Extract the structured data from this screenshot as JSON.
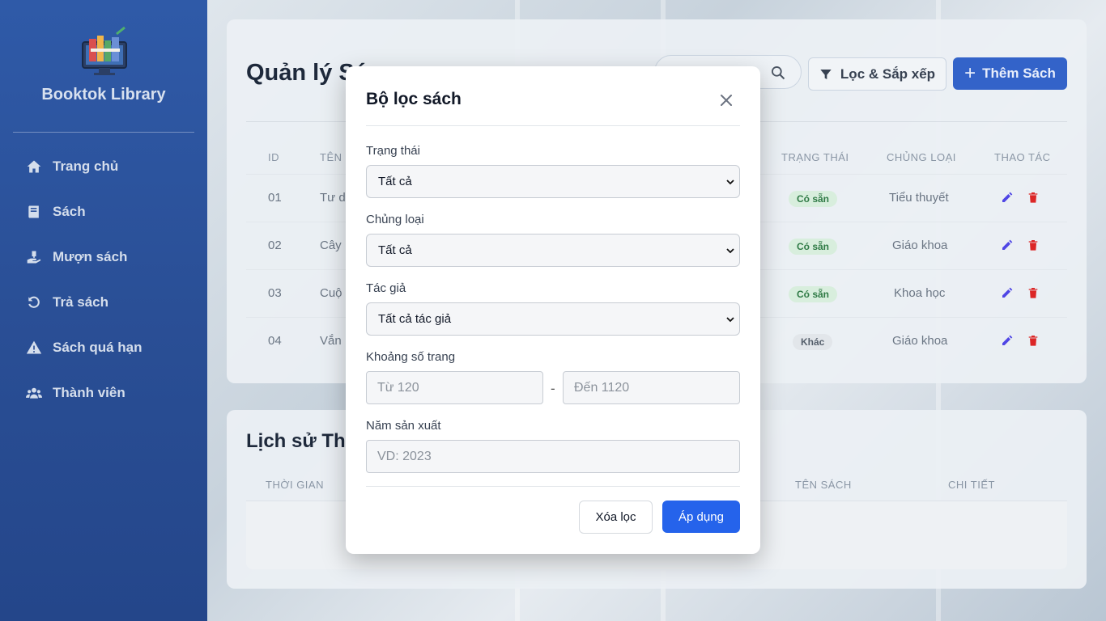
{
  "sidebar": {
    "brand": "Booktok Library",
    "items": [
      {
        "label": "Trang chủ",
        "icon": "home-icon"
      },
      {
        "label": "Sách",
        "icon": "book-icon"
      },
      {
        "label": "Mượn sách",
        "icon": "hand-book-icon"
      },
      {
        "label": "Trả sách",
        "icon": "undo-icon"
      },
      {
        "label": "Sách quá hạn",
        "icon": "warning-icon"
      },
      {
        "label": "Thành viên",
        "icon": "users-icon"
      }
    ]
  },
  "header": {
    "title": "Quản lý Sá",
    "filter_label": "Lọc & Sắp xếp",
    "add_label": "Thêm Sách"
  },
  "table": {
    "columns": [
      "ID",
      "TÊN",
      "TRẠNG THÁI",
      "CHỦNG LOẠI",
      "THAO TÁC"
    ],
    "rows": [
      {
        "id": "01",
        "name": "Tư d",
        "status": "Có sẵn",
        "category": "Tiểu thuyết"
      },
      {
        "id": "02",
        "name": "Cây",
        "status": "Có sẵn",
        "category": "Giáo khoa"
      },
      {
        "id": "03",
        "name": "Cuộ",
        "status": "Có sẵn",
        "category": "Khoa học"
      },
      {
        "id": "04",
        "name": "Vắn",
        "status": "Khác",
        "category": "Giáo khoa"
      }
    ]
  },
  "history": {
    "title": "Lịch sử Th",
    "columns": [
      "THỜI GIAN",
      "TÊN SÁCH",
      "CHI TIẾT"
    ]
  },
  "modal": {
    "title": "Bộ lọc sách",
    "status_label": "Trạng thái",
    "status_value": "Tất cả",
    "category_label": "Chủng loại",
    "category_value": "Tất cả",
    "author_label": "Tác giả",
    "author_value": "Tất cả tác giả",
    "pages_label": "Khoảng số trang",
    "pages_from_placeholder": "Từ 120",
    "pages_separator": "-",
    "pages_to_placeholder": "Đến 1120",
    "year_label": "Năm sản xuất",
    "year_placeholder": "VD: 2023",
    "clear_label": "Xóa lọc",
    "apply_label": "Áp dụng"
  },
  "colors": {
    "sidebar": "#2a4f96",
    "primary": "#2563eb",
    "badge_ok": "#2f7a45",
    "delete": "#dc2626",
    "edit": "#4f46e5"
  }
}
